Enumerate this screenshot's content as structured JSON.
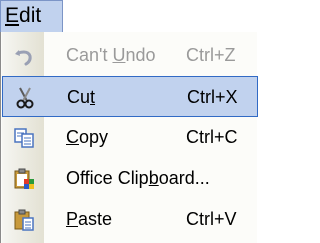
{
  "menu": {
    "title": {
      "before": "",
      "accel": "E",
      "after": "dit"
    },
    "items": [
      {
        "before": "Can't ",
        "accel": "U",
        "after": "ndo",
        "shortcut": "Ctrl+Z",
        "icon": "undo-icon",
        "disabled": true
      },
      {
        "before": "Cu",
        "accel": "t",
        "after": "",
        "shortcut": "Ctrl+X",
        "icon": "scissors-icon",
        "selected": true
      },
      {
        "before": "",
        "accel": "C",
        "after": "opy",
        "shortcut": "Ctrl+C",
        "icon": "copy-icon"
      },
      {
        "before": "Office Clip",
        "accel": "b",
        "after": "oard...",
        "shortcut": "",
        "icon": "office-clipboard-icon"
      },
      {
        "before": "",
        "accel": "P",
        "after": "aste",
        "shortcut": "Ctrl+V",
        "icon": "paste-icon"
      }
    ]
  },
  "colors": {
    "highlight": "#c1d2ee",
    "highlight_border": "#316ac5",
    "disabled_text": "#9a9a9a"
  }
}
